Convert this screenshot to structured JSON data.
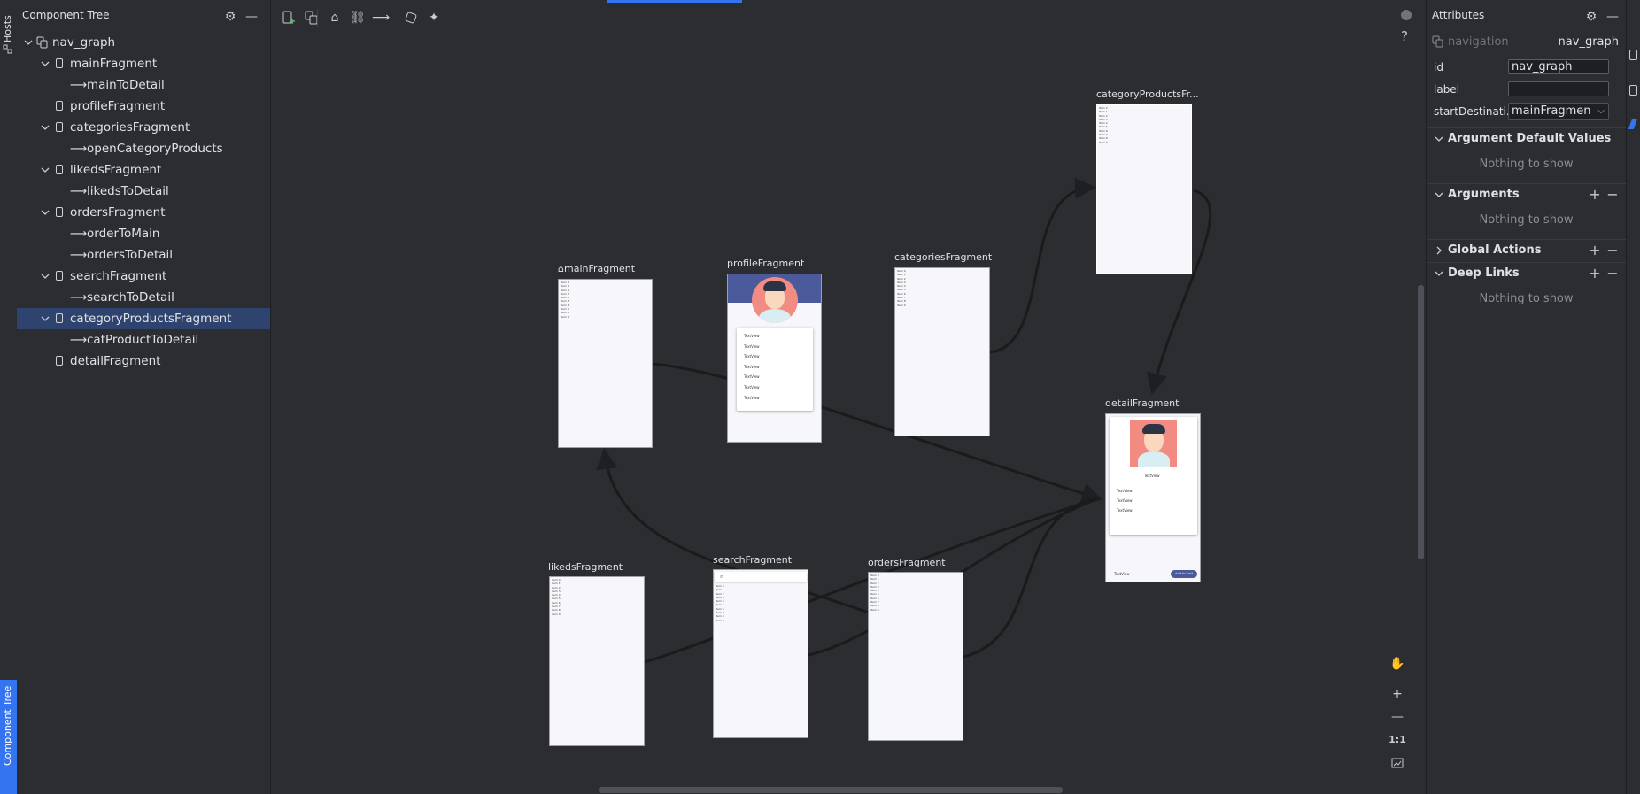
{
  "left_stripe": {
    "hosts_tab": "Hosts",
    "component_tree_tab": "Component Tree"
  },
  "component_tree": {
    "title": "Component Tree",
    "items": [
      {
        "label": "nav_graph",
        "kind": "graph",
        "expanded": true,
        "level": 0
      },
      {
        "label": "mainFragment",
        "kind": "fragment",
        "expanded": true,
        "level": 1
      },
      {
        "label": "mainToDetail",
        "kind": "action",
        "level": 2
      },
      {
        "label": "profileFragment",
        "kind": "fragment",
        "level": 1
      },
      {
        "label": "categoriesFragment",
        "kind": "fragment",
        "expanded": true,
        "level": 1
      },
      {
        "label": "openCategoryProducts",
        "kind": "action",
        "level": 2
      },
      {
        "label": "likedsFragment",
        "kind": "fragment",
        "expanded": true,
        "level": 1
      },
      {
        "label": "likedsToDetail",
        "kind": "action",
        "level": 2
      },
      {
        "label": "ordersFragment",
        "kind": "fragment",
        "expanded": true,
        "level": 1
      },
      {
        "label": "orderToMain",
        "kind": "action",
        "level": 2
      },
      {
        "label": "ordersToDetail",
        "kind": "action",
        "level": 2
      },
      {
        "label": "searchFragment",
        "kind": "fragment",
        "expanded": true,
        "level": 1
      },
      {
        "label": "searchToDetail",
        "kind": "action",
        "level": 2
      },
      {
        "label": "categoryProductsFragment",
        "kind": "fragment",
        "expanded": true,
        "level": 1,
        "selected": true
      },
      {
        "label": "catProductToDetail",
        "kind": "action",
        "level": 2
      },
      {
        "label": "detailFragment",
        "kind": "fragment",
        "level": 1
      }
    ]
  },
  "toolbar": {
    "icons": [
      "new-destination-icon",
      "nested-graph-icon",
      "start-destination-icon",
      "deep-link-icon",
      "action-icon",
      "auto-arrange-icon",
      "magic-icon"
    ]
  },
  "canvas": {
    "fragments": {
      "main": {
        "title": "mainFragment",
        "items": [
          "Item 0",
          "Item 1",
          "Item 2",
          "Item 3",
          "Item 4",
          "Item 5",
          "Item 6",
          "Item 7",
          "Item 8",
          "Item 9"
        ]
      },
      "profile": {
        "title": "profileFragment",
        "rows": [
          "TextView",
          "TextView",
          "TextView",
          "TextView",
          "TextView",
          "TextView",
          "TextView"
        ]
      },
      "categories": {
        "title": "categoriesFragment",
        "items": [
          "Item 0",
          "Item 1",
          "Item 2",
          "Item 3",
          "Item 4",
          "Item 5",
          "Item 6",
          "Item 7",
          "Item 8",
          "Item 9"
        ]
      },
      "categoryProducts": {
        "title": "categoryProductsFr...",
        "items": [
          "Item 0",
          "Item 1",
          "Item 2",
          "Item 3",
          "Item 4",
          "Item 5",
          "Item 6",
          "Item 7",
          "Item 8",
          "Item 9"
        ]
      },
      "detail": {
        "title": "detailFragment",
        "name": "TextView",
        "lines": [
          "TextView",
          "TextView",
          "TextView"
        ],
        "price": "TextView",
        "button": "Add to Cart"
      },
      "likeds": {
        "title": "likedsFragment",
        "items": [
          "Item 0",
          "Item 1",
          "Item 2",
          "Item 3",
          "Item 4",
          "Item 5",
          "Item 6",
          "Item 7",
          "Item 8",
          "Item 9"
        ]
      },
      "search": {
        "title": "searchFragment",
        "items": [
          "Item 0",
          "Item 1",
          "Item 2",
          "Item 3",
          "Item 4",
          "Item 5",
          "Item 6",
          "Item 7",
          "Item 8",
          "Item 9"
        ]
      },
      "orders": {
        "title": "ordersFragment",
        "items": [
          "Item 0",
          "Item 1",
          "Item 2",
          "Item 3",
          "Item 4",
          "Item 5",
          "Item 6",
          "Item 7",
          "Item 8",
          "Item 9"
        ]
      }
    },
    "help": "?",
    "zoom_actual": "1:1"
  },
  "attributes": {
    "title": "Attributes",
    "type_label": "navigation",
    "type_value": "nav_graph",
    "fields": {
      "id_label": "id",
      "id_value": "nav_graph",
      "label_label": "label",
      "label_value": "",
      "start_label": "startDestinati...",
      "start_value": "mainFragmen"
    },
    "sections": {
      "arg_defaults": {
        "title": "Argument Default Values",
        "empty": "Nothing to show"
      },
      "arguments": {
        "title": "Arguments",
        "empty": "Nothing to show"
      },
      "global_actions": {
        "title": "Global Actions"
      },
      "deep_links": {
        "title": "Deep Links",
        "empty": "Nothing to show"
      }
    }
  },
  "colors": {
    "accent": "#3574f0",
    "selection": "#2e436e",
    "panel": "#2b2d30",
    "canvas": "#2b2d30"
  }
}
